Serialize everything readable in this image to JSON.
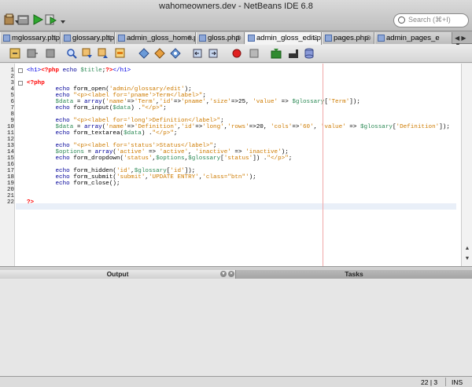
{
  "window": {
    "title": "wahomeowners.dev - NetBeans IDE 6.8"
  },
  "search": {
    "placeholder": "Search (⌘+I)"
  },
  "tabs": [
    {
      "label": "mglossary.php"
    },
    {
      "label": "glossary.php"
    },
    {
      "label": "admin_gloss_home.php"
    },
    {
      "label": "gloss.php"
    },
    {
      "label": "admin_gloss_edit.php",
      "active": true
    },
    {
      "label": "pages.php"
    },
    {
      "label": "admin_pages_e"
    }
  ],
  "editor": {
    "line_numbers": [
      "1",
      "2",
      "3",
      "4",
      "5",
      "6",
      "7",
      "8",
      "9",
      "10",
      "11",
      "12",
      "13",
      "14",
      "15",
      "16",
      "17",
      "18",
      "19",
      "20",
      "21",
      "22"
    ]
  },
  "panels": {
    "output_label": "Output",
    "tasks_label": "Tasks"
  },
  "status": {
    "position": "22 | 3",
    "mode": "INS"
  },
  "colors": {
    "keyword": "#000099",
    "string": "#ce7b00",
    "variable": "#2e8b57",
    "php_delim": "#ff0000",
    "margin": "#f1a8a8"
  }
}
